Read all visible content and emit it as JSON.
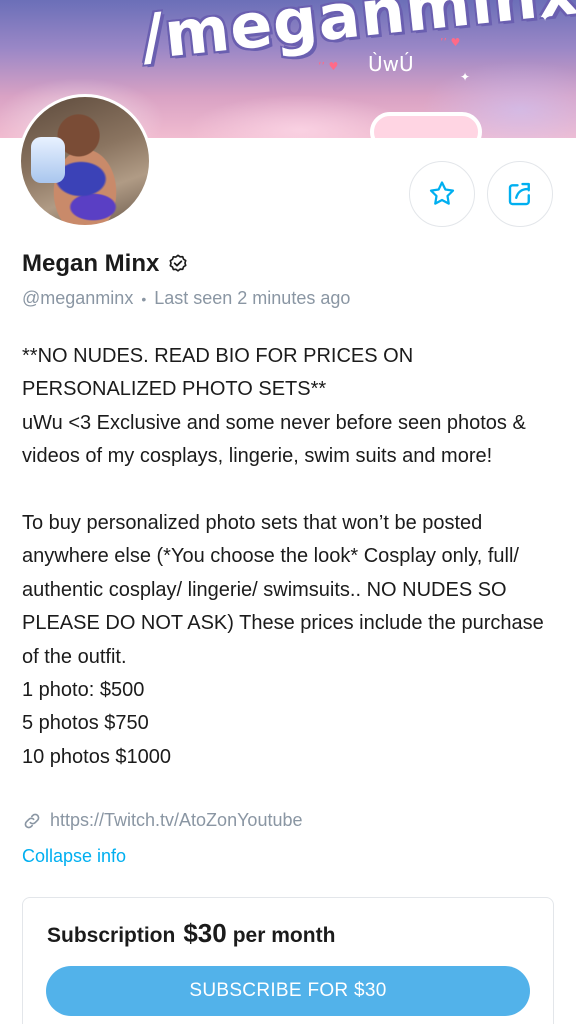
{
  "banner": {
    "text": "/meganminx",
    "face": "ÙwÚ",
    "blush_left": "’’ ♥",
    "blush_right": "’’ ♥"
  },
  "profile": {
    "name": "Megan Minx",
    "verified_icon": "verified-badge-icon",
    "username": "@meganminx",
    "separator": "•",
    "last_seen": "Last seen 2 minutes ago"
  },
  "actions": {
    "favorite_icon": "star-icon",
    "share_icon": "share-icon"
  },
  "bio": {
    "text": "**NO NUDES. READ BIO FOR PRICES ON PERSONALIZED PHOTO SETS**\nuWu <3 Exclusive and some never before seen photos & videos of my cosplays, lingerie, swim suits and more!\n\nTo buy personalized photo sets that won’t be posted anywhere else (*You choose the look* Cosplay only, full/ authentic cosplay/ lingerie/ swimsuits.. NO NUDES SO PLEASE DO NOT ASK) These prices include the purchase of the outfit.\n1 photo: $500\n5 photos $750\n10 photos $1000"
  },
  "link": {
    "icon": "link-icon",
    "url": "https://Twitch.tv/AtoZonYoutube"
  },
  "collapse_label": "Collapse info",
  "subscription": {
    "label": "Subscription",
    "price": "$30",
    "period": "per month",
    "button_label": "SUBSCRIBE FOR $30"
  },
  "colors": {
    "accent": "#00aff0",
    "button": "#52b2ea",
    "muted_text": "#8a96a3",
    "border": "#e3e6ea"
  }
}
